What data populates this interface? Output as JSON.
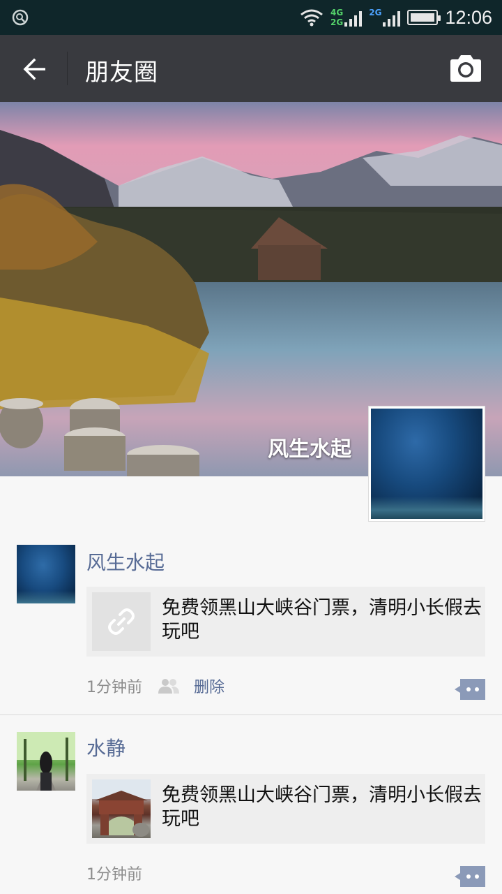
{
  "status_bar": {
    "time": "12:06",
    "network_tag_top": "4G",
    "network_tag_bottom": "2G",
    "network_tag_2": "2G"
  },
  "header": {
    "title": "朋友圈",
    "back_icon": "arrow-left-icon",
    "camera_icon": "camera-icon"
  },
  "cover": {
    "name": "风生水起"
  },
  "posts": [
    {
      "author": "风生水起",
      "link_text": "免费领黑山大峡谷门票，清明小长假去玩吧",
      "time": "1分钟前",
      "delete_label": "删除",
      "link_icon": "link-icon"
    },
    {
      "author": "水静",
      "link_text": "免费领黑山大峡谷门票，清明小长假去玩吧",
      "time": "1分钟前"
    }
  ],
  "colors": {
    "status_bar": "#0f262a",
    "header": "#393a3f",
    "username": "#576b95",
    "background": "#f7f7f7"
  }
}
